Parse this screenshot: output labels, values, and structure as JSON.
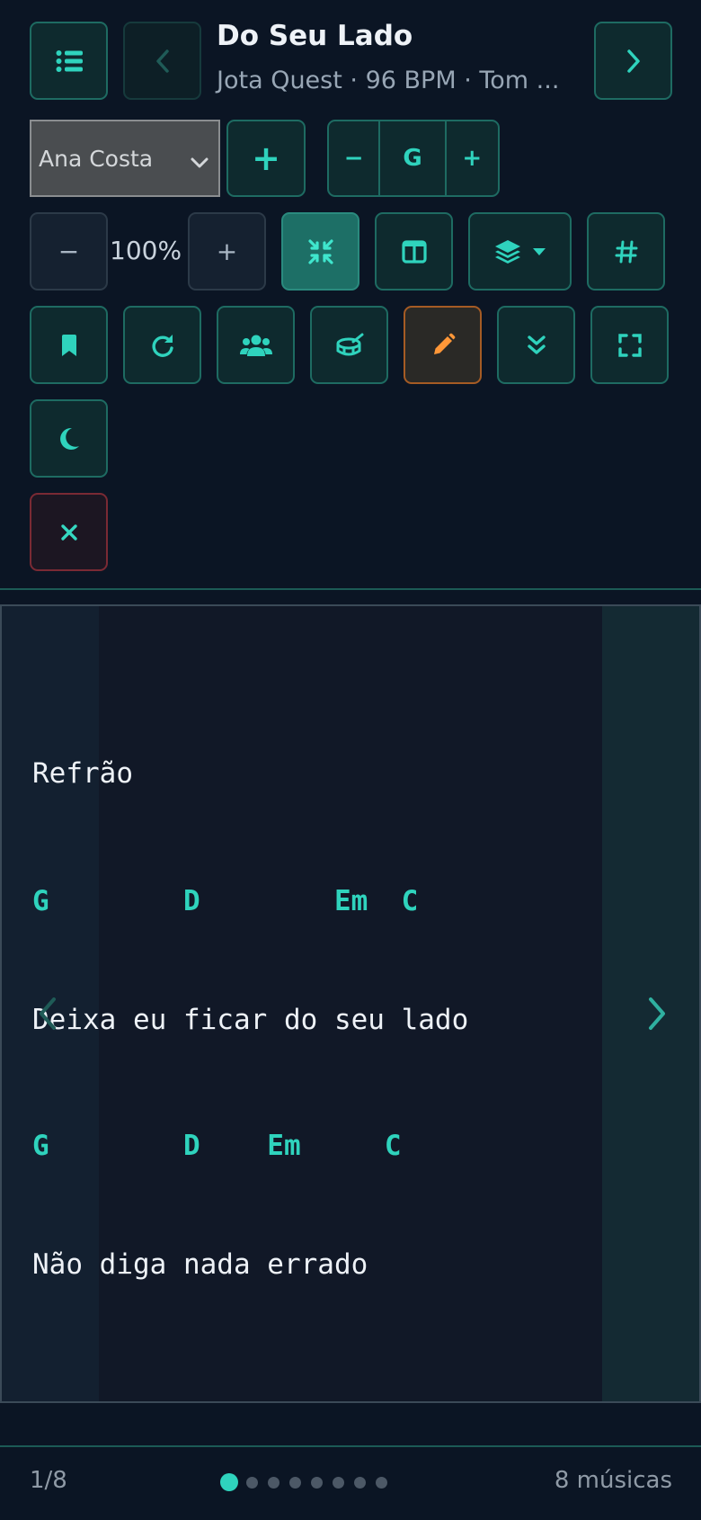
{
  "header": {
    "title": "Do Seu Lado",
    "subtitle": "Jota Quest · 96 BPM · Tom ..."
  },
  "controls": {
    "musician_select": {
      "selected": "Ana Costa"
    },
    "add_label": "+",
    "transpose": {
      "minus": "−",
      "key": "G",
      "plus": "+"
    },
    "zoom": {
      "minus": "−",
      "value": "100%",
      "plus": "+"
    }
  },
  "icons": {
    "list": "list-icon",
    "prev": "chevron-left-icon",
    "next": "chevron-right-icon",
    "compress": "compress-icon",
    "columns": "columns-icon",
    "layers": "layers-icon",
    "hash": "hash-icon",
    "bookmark": "bookmark-icon",
    "redo": "redo-icon",
    "users": "users-icon",
    "drum": "drum-icon",
    "edit": "pencil-icon",
    "scroll": "double-chevron-down-icon",
    "fullscreen": "expand-icon",
    "night": "moon-icon",
    "close": "close-icon"
  },
  "sheet": {
    "section": "Refrão",
    "lines": [
      {
        "chords": "G        D        Em  C",
        "lyrics": "Deixa eu ficar do seu lado"
      },
      {
        "chords": "G        D    Em     C",
        "lyrics": "Não diga nada errado"
      }
    ]
  },
  "footer": {
    "page": "1/8",
    "total": "8 músicas",
    "dots_total": 8,
    "dots_active": 1
  },
  "colors": {
    "background": "#0b1524",
    "accent": "#2fd3bd",
    "edit_accent": "#ff9738",
    "danger_border": "#7a2a34"
  }
}
